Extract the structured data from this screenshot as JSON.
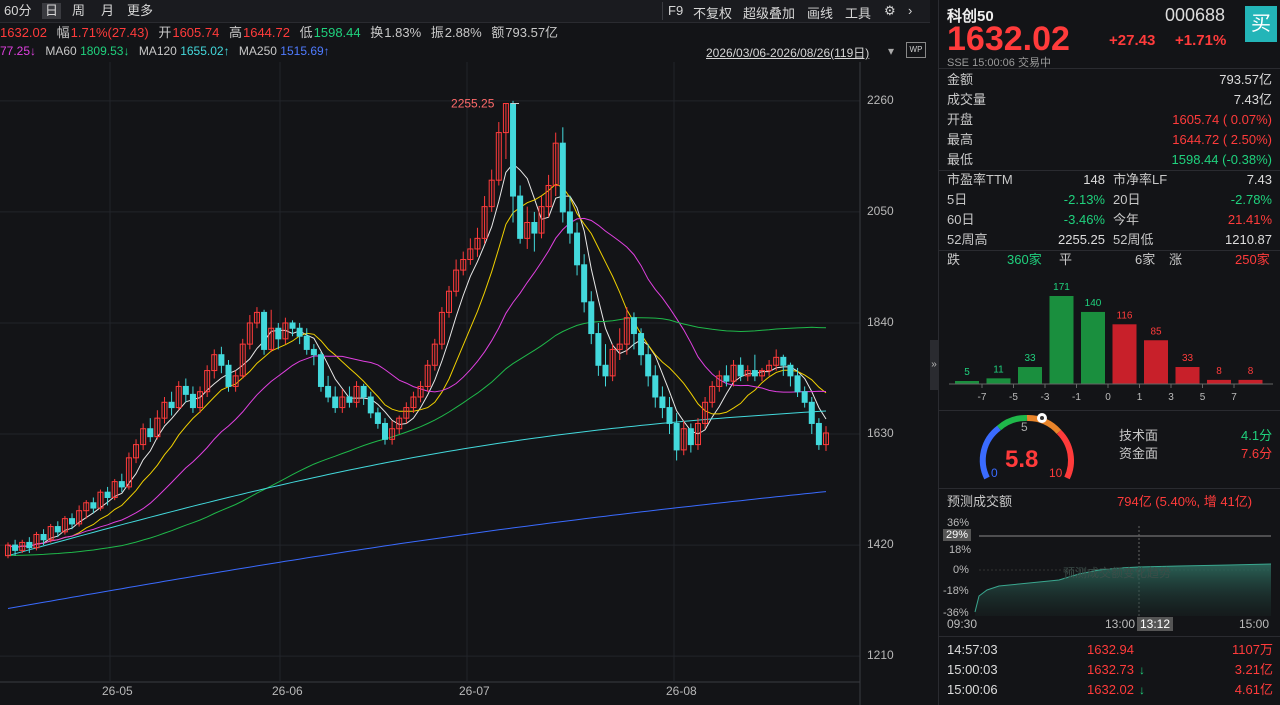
{
  "toolbar": {
    "items": [
      "60分",
      "日",
      "周",
      "月",
      "更多"
    ],
    "right_items": [
      "F9",
      "不复权",
      "超级叠加",
      "画线",
      "工具"
    ]
  },
  "quote_bar": {
    "price": "1632.02",
    "amp_label": "幅",
    "amp_value": "1.71%(27.43)",
    "open_label": "开",
    "open_value": "1605.74",
    "high_label": "高",
    "high_value": "1644.72",
    "low_label": "低",
    "low_value": "1598.44",
    "turn_label": "换",
    "turn_value": "1.83%",
    "swing_label": "振",
    "swing_value": "2.88%",
    "amt_label": "额",
    "amt_value": "793.57亿"
  },
  "ma_bar": {
    "ma_first": "77.25↓",
    "ma60": "MA60",
    "ma60_v": "1809.53↓",
    "ma120": "MA120",
    "ma120_v": "1655.02↑",
    "ma250": "MA250",
    "ma250_v": "1515.69↑",
    "range": "2026/03/06-2026/08/26(119日)"
  },
  "chart_data": {
    "type": "candlestick",
    "ylim": [
      1180,
      2290
    ],
    "y_ticks": [
      "2260",
      "2050",
      "1840",
      "1630",
      "1420",
      "1210"
    ],
    "x_ticks": [
      "26-05",
      "26-06",
      "26-07",
      "26-08"
    ],
    "high_annotation": "2255.25",
    "colors": {
      "up": "#ff3b3b",
      "down": "#43d9dc",
      "ma5": "#e8e8e8",
      "ma10": "#f0d000",
      "ma20": "#e040e0",
      "ma60": "#1fb84a",
      "ma120": "#43d9dc",
      "ma250": "#3a6bff"
    },
    "candles": [
      [
        1400,
        1420,
        1395,
        1425
      ],
      [
        1420,
        1410,
        1400,
        1430
      ],
      [
        1410,
        1425,
        1405,
        1430
      ],
      [
        1425,
        1415,
        1405,
        1435
      ],
      [
        1415,
        1440,
        1410,
        1445
      ],
      [
        1440,
        1430,
        1420,
        1450
      ],
      [
        1430,
        1455,
        1425,
        1460
      ],
      [
        1455,
        1445,
        1435,
        1465
      ],
      [
        1445,
        1470,
        1440,
        1475
      ],
      [
        1470,
        1460,
        1450,
        1480
      ],
      [
        1460,
        1485,
        1455,
        1495
      ],
      [
        1485,
        1500,
        1470,
        1505
      ],
      [
        1500,
        1490,
        1480,
        1510
      ],
      [
        1490,
        1520,
        1485,
        1525
      ],
      [
        1520,
        1510,
        1495,
        1530
      ],
      [
        1510,
        1540,
        1505,
        1545
      ],
      [
        1540,
        1530,
        1520,
        1555
      ],
      [
        1530,
        1585,
        1525,
        1595
      ],
      [
        1585,
        1610,
        1575,
        1620
      ],
      [
        1610,
        1640,
        1600,
        1650
      ],
      [
        1640,
        1625,
        1615,
        1660
      ],
      [
        1625,
        1660,
        1620,
        1675
      ],
      [
        1660,
        1690,
        1650,
        1700
      ],
      [
        1690,
        1680,
        1665,
        1710
      ],
      [
        1680,
        1720,
        1675,
        1730
      ],
      [
        1720,
        1705,
        1690,
        1735
      ],
      [
        1705,
        1680,
        1670,
        1720
      ],
      [
        1680,
        1710,
        1670,
        1720
      ],
      [
        1710,
        1750,
        1700,
        1760
      ],
      [
        1750,
        1780,
        1735,
        1790
      ],
      [
        1780,
        1760,
        1745,
        1795
      ],
      [
        1760,
        1720,
        1710,
        1770
      ],
      [
        1720,
        1740,
        1710,
        1750
      ],
      [
        1740,
        1800,
        1735,
        1810
      ],
      [
        1800,
        1840,
        1790,
        1855
      ],
      [
        1840,
        1860,
        1830,
        1870
      ],
      [
        1860,
        1790,
        1780,
        1865
      ],
      [
        1790,
        1830,
        1785,
        1865
      ],
      [
        1830,
        1810,
        1790,
        1840
      ],
      [
        1810,
        1840,
        1800,
        1850
      ],
      [
        1840,
        1830,
        1815,
        1845
      ],
      [
        1830,
        1815,
        1800,
        1840
      ],
      [
        1815,
        1790,
        1780,
        1830
      ],
      [
        1790,
        1780,
        1760,
        1800
      ],
      [
        1780,
        1720,
        1710,
        1785
      ],
      [
        1720,
        1700,
        1690,
        1740
      ],
      [
        1700,
        1680,
        1670,
        1720
      ],
      [
        1680,
        1700,
        1670,
        1715
      ],
      [
        1700,
        1690,
        1680,
        1720
      ],
      [
        1690,
        1720,
        1680,
        1730
      ],
      [
        1720,
        1700,
        1685,
        1725
      ],
      [
        1700,
        1670,
        1660,
        1710
      ],
      [
        1670,
        1650,
        1640,
        1680
      ],
      [
        1650,
        1620,
        1610,
        1660
      ],
      [
        1620,
        1640,
        1610,
        1655
      ],
      [
        1640,
        1660,
        1630,
        1665
      ],
      [
        1660,
        1680,
        1650,
        1690
      ],
      [
        1680,
        1700,
        1670,
        1710
      ],
      [
        1700,
        1720,
        1690,
        1730
      ],
      [
        1720,
        1760,
        1710,
        1770
      ],
      [
        1760,
        1800,
        1750,
        1810
      ],
      [
        1800,
        1860,
        1790,
        1870
      ],
      [
        1860,
        1900,
        1850,
        1910
      ],
      [
        1900,
        1940,
        1890,
        1960
      ],
      [
        1940,
        1960,
        1930,
        1975
      ],
      [
        1960,
        1980,
        1950,
        2000
      ],
      [
        1980,
        2000,
        1965,
        2020
      ],
      [
        2000,
        2060,
        1990,
        2080
      ],
      [
        2060,
        2110,
        2050,
        2130
      ],
      [
        2110,
        2200,
        2100,
        2220
      ],
      [
        2200,
        2255,
        2150,
        2255
      ],
      [
        2255,
        2080,
        2030,
        2260
      ],
      [
        2080,
        2000,
        1990,
        2100
      ],
      [
        2000,
        2030,
        1980,
        2060
      ],
      [
        2030,
        2010,
        1975,
        2050
      ],
      [
        2010,
        2060,
        2000,
        2080
      ],
      [
        2060,
        2100,
        2040,
        2120
      ],
      [
        2100,
        2180,
        2080,
        2200
      ],
      [
        2180,
        2050,
        2030,
        2210
      ],
      [
        2050,
        2010,
        1990,
        2080
      ],
      [
        2010,
        1950,
        1930,
        2030
      ],
      [
        1950,
        1880,
        1860,
        1970
      ],
      [
        1880,
        1820,
        1800,
        1900
      ],
      [
        1820,
        1760,
        1740,
        1840
      ],
      [
        1760,
        1740,
        1720,
        1800
      ],
      [
        1740,
        1790,
        1730,
        1800
      ],
      [
        1790,
        1800,
        1770,
        1830
      ],
      [
        1800,
        1850,
        1780,
        1870
      ],
      [
        1850,
        1820,
        1790,
        1860
      ],
      [
        1820,
        1780,
        1760,
        1830
      ],
      [
        1780,
        1740,
        1720,
        1800
      ],
      [
        1740,
        1700,
        1680,
        1760
      ],
      [
        1700,
        1680,
        1660,
        1720
      ],
      [
        1680,
        1650,
        1630,
        1700
      ],
      [
        1650,
        1600,
        1580,
        1670
      ],
      [
        1600,
        1640,
        1590,
        1655
      ],
      [
        1640,
        1610,
        1595,
        1650
      ],
      [
        1610,
        1650,
        1600,
        1660
      ],
      [
        1650,
        1690,
        1640,
        1700
      ],
      [
        1690,
        1720,
        1680,
        1730
      ],
      [
        1720,
        1740,
        1710,
        1750
      ],
      [
        1740,
        1730,
        1720,
        1760
      ],
      [
        1730,
        1760,
        1720,
        1770
      ],
      [
        1760,
        1740,
        1730,
        1775
      ],
      [
        1740,
        1750,
        1730,
        1760
      ],
      [
        1750,
        1740,
        1730,
        1780
      ],
      [
        1740,
        1750,
        1730,
        1755
      ],
      [
        1750,
        1760,
        1740,
        1770
      ],
      [
        1760,
        1775,
        1750,
        1790
      ],
      [
        1775,
        1760,
        1740,
        1780
      ],
      [
        1760,
        1740,
        1720,
        1765
      ],
      [
        1740,
        1710,
        1700,
        1755
      ],
      [
        1710,
        1690,
        1680,
        1720
      ],
      [
        1690,
        1650,
        1630,
        1700
      ],
      [
        1650,
        1610,
        1600,
        1660
      ],
      [
        1610,
        1632,
        1598,
        1645
      ]
    ]
  },
  "header": {
    "name": "科创50",
    "code": "000688",
    "price": "1632.02",
    "change": "+27.43",
    "pct": "+1.71%",
    "market": "SSE",
    "time": "15:00:06",
    "status": "交易中",
    "buy": "买"
  },
  "stats": [
    {
      "label": "金额",
      "value": "793.57亿"
    },
    {
      "label": "成交量",
      "value": "7.43亿"
    },
    {
      "label": "开盘",
      "value": "1605.74 ( 0.07%)"
    },
    {
      "label": "最高",
      "value": "1644.72 ( 2.50%)"
    },
    {
      "label": "最低",
      "value": "1598.44 (-0.38%)"
    }
  ],
  "grid": [
    {
      "l": "市盈率TTM",
      "v": "148",
      "l2": "市净率LF",
      "v2": "7.43"
    },
    {
      "l": "5日",
      "v": "-2.13%",
      "l2": "20日",
      "v2": "-2.78%"
    },
    {
      "l": "60日",
      "v": "-3.46%",
      "l2": "今年",
      "v2": "21.41%"
    },
    {
      "l": "52周高",
      "v": "2255.25",
      "l2": "52周低",
      "v2": "1210.87"
    }
  ],
  "breadth": {
    "down_label": "跌",
    "down": "360家",
    "flat_label": "平",
    "flat": "6家",
    "up_label": "涨",
    "up": "250家"
  },
  "dist": {
    "values": [
      5,
      11,
      33,
      171,
      140,
      116,
      85,
      33,
      8,
      8
    ],
    "labels": [
      "-7",
      "-5",
      "-3",
      "-1",
      "0",
      "1",
      "3",
      "5",
      "7"
    ]
  },
  "gauge": {
    "score": "5.8",
    "min": "0",
    "mid": "5",
    "max": "10",
    "tech_label": "技术面",
    "tech": "4.1分",
    "fund_label": "资金面",
    "fund": "7.6分"
  },
  "forecast": {
    "label": "预测成交额",
    "value": "794亿 (5.40%, 增 41亿)",
    "marker": "29%",
    "ticks": [
      "36%",
      "18%",
      "0%",
      "-18%",
      "-36%"
    ],
    "times": [
      "09:30",
      "13:00",
      "13:12",
      "15:00"
    ],
    "watermark": "预测成交额变化趋势"
  },
  "trades": [
    {
      "time": "14:57:03",
      "price": "1632.94",
      "arrow": "",
      "vol": "1107万"
    },
    {
      "time": "15:00:03",
      "price": "1632.73",
      "arrow": "↓",
      "vol": "3.21亿"
    },
    {
      "time": "15:00:06",
      "price": "1632.02",
      "arrow": "↓",
      "vol": "4.61亿"
    }
  ]
}
